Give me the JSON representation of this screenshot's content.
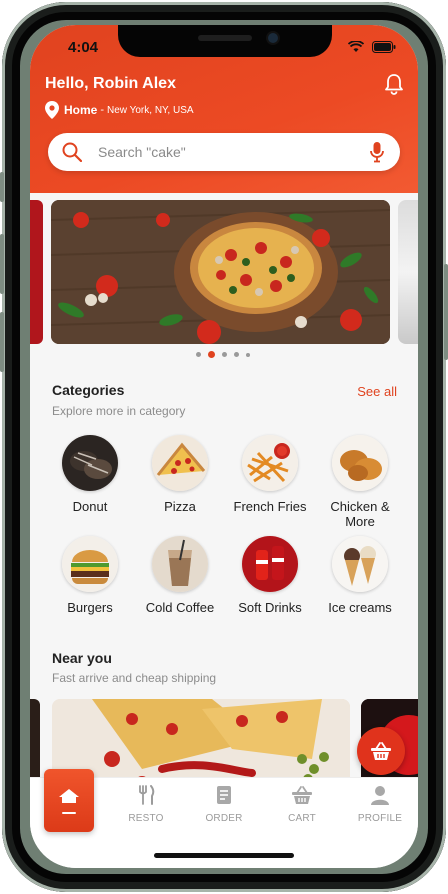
{
  "status": {
    "time": "4:04"
  },
  "header": {
    "greeting": "Hello, Robin Alex",
    "location_label": "Home",
    "location_separator": "-",
    "location_city": "New York, NY, USA"
  },
  "search": {
    "placeholder": "Search \"cake\""
  },
  "banner": {
    "slide_count": 5,
    "active_slide_index": 1
  },
  "categories": {
    "title": "Categories",
    "subtitle": "Explore more in category",
    "see_all_label": "See all",
    "items": [
      {
        "label": "Donut",
        "icon": "donut"
      },
      {
        "label": "Pizza",
        "icon": "pizza"
      },
      {
        "label": "French Fries",
        "icon": "french-fries"
      },
      {
        "label": "Chicken & More",
        "icon": "fried-chicken"
      },
      {
        "label": "Burgers",
        "icon": "burger"
      },
      {
        "label": "Cold Coffee",
        "icon": "cold-coffee"
      },
      {
        "label": "Soft Drinks",
        "icon": "soft-drinks"
      },
      {
        "label": "Ice creams",
        "icon": "ice-cream"
      }
    ]
  },
  "near_you": {
    "title": "Near you",
    "subtitle": "Fast arrive and cheap shipping"
  },
  "bottom_nav": {
    "items": [
      {
        "label": "",
        "icon": "home-icon",
        "active": true
      },
      {
        "label": "RESTO",
        "icon": "fork-knife-icon"
      },
      {
        "label": "ORDER",
        "icon": "receipt-icon"
      },
      {
        "label": "CART",
        "icon": "basket-icon"
      },
      {
        "label": "PROFILE",
        "icon": "user-icon"
      }
    ]
  },
  "colors": {
    "accent": "#e0431f",
    "header_gradient_end": "#f25a32",
    "nav_inactive": "#9b9b9b"
  }
}
